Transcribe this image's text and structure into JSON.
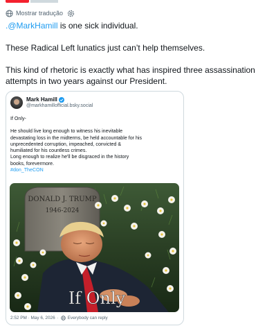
{
  "header": {
    "translate_label": "Mostrar tradução"
  },
  "tweet": {
    "mention": ".@MarkHamill",
    "line1_rest": " is one sick individual.",
    "line2": "These Radical Left lunatics just can’t help themselves.",
    "line3a": "This kind of rhetoric is exactly what has inspired three assassination",
    "line3b": "attempts in two years against our President."
  },
  "quoted_post": {
    "author_name": "Mark Hamill",
    "author_handle": "@markhamillofficial.bsky.social",
    "body": {
      "l1": "If Only-",
      "l2": "He should live long enough to witness his inevitable",
      "l3": "devastating loss in the midterms, be held accountable for his",
      "l4": "unprecedented corruption, impeached, convicted &",
      "l5": "humiliated for his countless crimes.",
      "l6": "Long enough to realize he'll be disgraced in the history",
      "l7": "books, forevermore.",
      "hashtag": "#don_TheCON"
    },
    "image": {
      "headstone_name": "DONALD J. TRUMP",
      "headstone_years": "1946-2024",
      "caption": "If Only"
    },
    "footer": {
      "timestamp": "2:52 PM · May 6, 2026",
      "reply_setting": "Everybody can reply"
    }
  },
  "colors": {
    "link": "#1d9bf0",
    "text": "#0f1419",
    "secondary": "#536471",
    "border": "#cfd9de",
    "accent_red": "#f4212e"
  }
}
